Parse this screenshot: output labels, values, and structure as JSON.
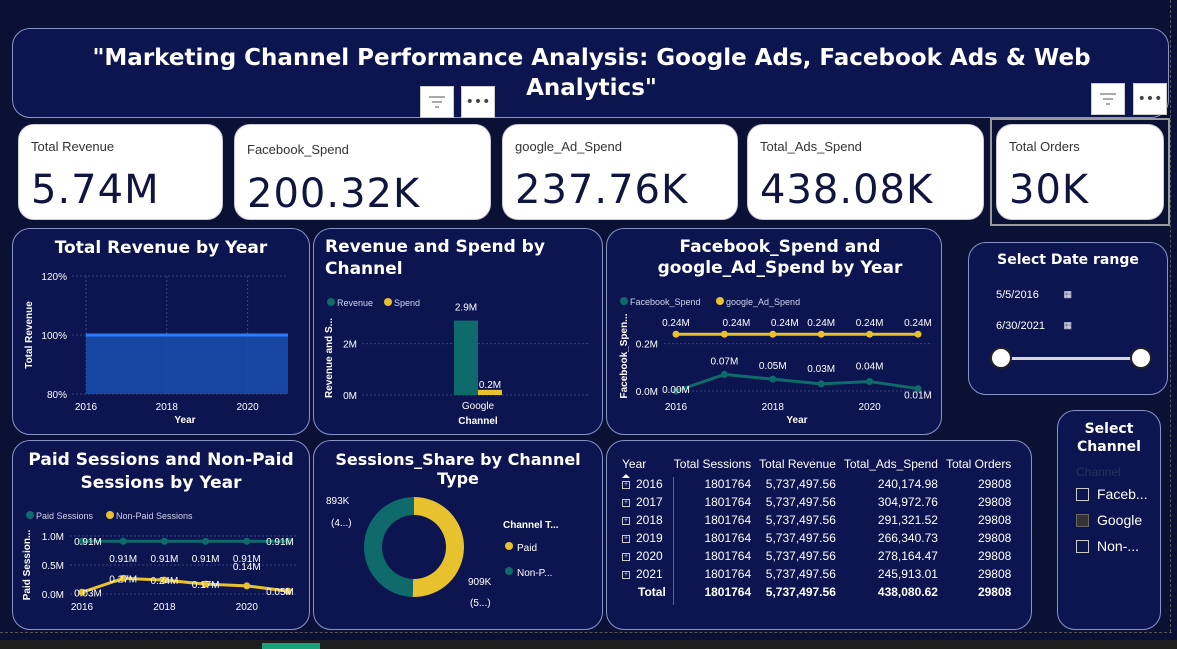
{
  "page": {
    "title": "\"Marketing Channel Performance Analysis: Google Ads, Facebook Ads & Web Analytics\""
  },
  "kpis": [
    {
      "label": "Total Revenue",
      "value": "5.74M"
    },
    {
      "label": "Facebook_Spend",
      "value": "200.32K"
    },
    {
      "label": "google_Ad_Spend",
      "value": "237.76K"
    },
    {
      "label": "Total_Ads_Spend",
      "value": "438.08K"
    },
    {
      "label": "Total Orders",
      "value": "30K"
    }
  ],
  "revenue_by_year": {
    "title": "Total Revenue by Year",
    "ylabel": "Total Revenue",
    "xlabel": "Year",
    "yticks": [
      "120%",
      "100%",
      "80%"
    ],
    "xticks": [
      "2016",
      "2018",
      "2020"
    ]
  },
  "rev_spend_channel": {
    "title": "Revenue and Spend by Channel",
    "legend": [
      "Revenue",
      "Spend"
    ],
    "ylabel": "Revenue and S...",
    "xlabel": "Channel",
    "yticks": [
      "2M",
      "0M"
    ],
    "category": "Google",
    "labels": [
      "2.9M",
      "0.2M"
    ]
  },
  "fb_google_spend": {
    "title": "Facebook_Spend and google_Ad_Spend by Year",
    "legend": [
      "Facebook_Spend",
      "google_Ad_Spend"
    ],
    "ylabel": "Facebook_Spen...",
    "xlabel": "Year",
    "yticks": [
      "0.2M",
      "0.0M"
    ],
    "xticks": [
      "2016",
      "2018",
      "2020"
    ],
    "google_labels": [
      "0.24M",
      "0.24M",
      "0.24M",
      "0.24M",
      "0.24M",
      "0.24M"
    ],
    "fb_labels": [
      "0.00M",
      "0.07M",
      "0.05M",
      "0.03M",
      "0.04M",
      "0.01M"
    ]
  },
  "sessions_year": {
    "title": "Paid Sessions and Non-Paid Sessions by Year",
    "legend": [
      "Paid Sessions",
      "Non-Paid Sessions"
    ],
    "ylabel": "Paid Session...",
    "yticks": [
      "1.0M",
      "0.5M",
      "0.0M"
    ],
    "xticks": [
      "2016",
      "2018",
      "2020"
    ],
    "paid_labels": [
      "0.91M",
      "0.91M",
      "0.91M",
      "0.91M",
      "0.91M",
      "0.91M"
    ],
    "nonpaid_labels": [
      "0.03M",
      "0.27M",
      "0.24M",
      "0.17M",
      "0.14M",
      "0.05M"
    ]
  },
  "sessions_share": {
    "title": "Sessions_Share by Channel Type",
    "legend_title": "Channel T...",
    "legend": [
      "Paid",
      "Non-P..."
    ],
    "label_left": [
      "893K",
      "(4...)"
    ],
    "label_right": [
      "909K",
      "(5...)"
    ]
  },
  "table": {
    "headers": [
      "Year",
      "Total Sessions",
      "Total Revenue",
      "Total_Ads_Spend",
      "Total Orders"
    ],
    "rows": [
      [
        "2016",
        "1801764",
        "5,737,497.56",
        "240,174.98",
        "29808"
      ],
      [
        "2017",
        "1801764",
        "5,737,497.56",
        "304,972.76",
        "29808"
      ],
      [
        "2018",
        "1801764",
        "5,737,497.56",
        "291,321.52",
        "29808"
      ],
      [
        "2019",
        "1801764",
        "5,737,497.56",
        "266,340.73",
        "29808"
      ],
      [
        "2020",
        "1801764",
        "5,737,497.56",
        "278,164.47",
        "29808"
      ],
      [
        "2021",
        "1801764",
        "5,737,497.56",
        "245,913.01",
        "29808"
      ]
    ],
    "total": [
      "Total",
      "1801764",
      "5,737,497.56",
      "438,080.62",
      "29808"
    ]
  },
  "date_range": {
    "title": "Select Date range",
    "start": "5/5/2016",
    "end": "6/30/2021"
  },
  "channel_slicer": {
    "title": "Select Channel",
    "header": "Channel",
    "items": [
      {
        "label": "Faceb...",
        "checked": false
      },
      {
        "label": "Google",
        "checked": true
      },
      {
        "label": "Non-...",
        "checked": false
      }
    ]
  },
  "colors": {
    "background": "#0b1035",
    "card": "#0d1550",
    "teal": "#0f6b6b",
    "yellow": "#e7c22e",
    "blue_area": "#1a4fb0"
  },
  "chart_data": [
    {
      "type": "area",
      "title": "Total Revenue by Year",
      "x": [
        2016,
        2017,
        2018,
        2019,
        2020,
        2021
      ],
      "values": [
        100,
        100,
        100,
        100,
        100,
        100
      ],
      "xlabel": "Year",
      "ylabel": "Total Revenue",
      "ylim": [
        80,
        120
      ]
    },
    {
      "type": "bar",
      "title": "Revenue and Spend by Channel",
      "categories": [
        "Google"
      ],
      "series": [
        {
          "name": "Revenue",
          "values": [
            2.9
          ]
        },
        {
          "name": "Spend",
          "values": [
            0.2
          ]
        }
      ],
      "xlabel": "Channel",
      "ylim": [
        0,
        3
      ]
    },
    {
      "type": "line",
      "title": "Facebook_Spend and google_Ad_Spend by Year",
      "x": [
        2016,
        2017,
        2018,
        2019,
        2020,
        2021
      ],
      "series": [
        {
          "name": "Facebook_Spend",
          "values": [
            0.0,
            0.07,
            0.05,
            0.03,
            0.04,
            0.01
          ]
        },
        {
          "name": "google_Ad_Spend",
          "values": [
            0.24,
            0.24,
            0.24,
            0.24,
            0.24,
            0.24
          ]
        }
      ],
      "xlabel": "Year",
      "ylim": [
        0,
        0.3
      ]
    },
    {
      "type": "line",
      "title": "Paid Sessions and Non-Paid Sessions by Year",
      "x": [
        2016,
        2017,
        2018,
        2019,
        2020,
        2021
      ],
      "series": [
        {
          "name": "Paid Sessions",
          "values": [
            0.91,
            0.91,
            0.91,
            0.91,
            0.91,
            0.91
          ]
        },
        {
          "name": "Non-Paid Sessions",
          "values": [
            0.03,
            0.27,
            0.24,
            0.17,
            0.14,
            0.05
          ]
        }
      ],
      "ylim": [
        0,
        1.0
      ]
    },
    {
      "type": "pie",
      "title": "Sessions_Share by Channel Type",
      "categories": [
        "Paid",
        "Non-P..."
      ],
      "values": [
        909,
        893
      ]
    }
  ]
}
